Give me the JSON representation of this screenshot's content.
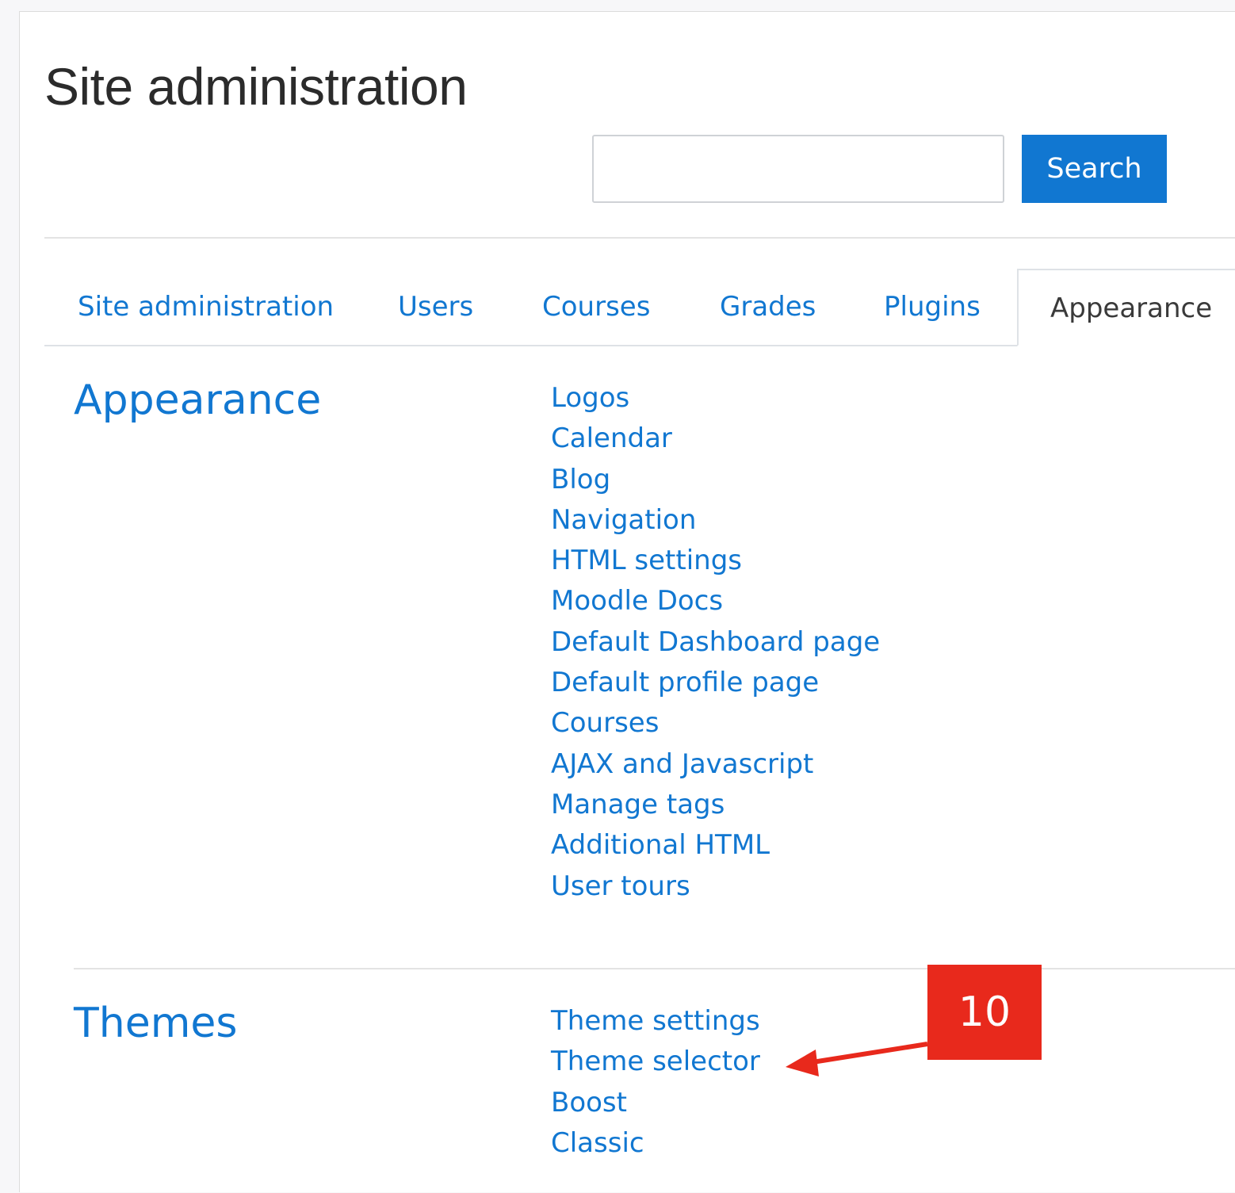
{
  "page_title": "Site administration",
  "search": {
    "value": "",
    "button_label": "Search"
  },
  "tabs": [
    {
      "label": "Site administration",
      "active": false
    },
    {
      "label": "Users",
      "active": false
    },
    {
      "label": "Courses",
      "active": false
    },
    {
      "label": "Grades",
      "active": false
    },
    {
      "label": "Plugins",
      "active": false
    },
    {
      "label": "Appearance",
      "active": true
    }
  ],
  "sections": [
    {
      "title": "Appearance",
      "links": [
        "Logos",
        "Calendar",
        "Blog",
        "Navigation",
        "HTML settings",
        "Moodle Docs",
        "Default Dashboard page",
        "Default profile page",
        "Courses",
        "AJAX and Javascript",
        "Manage tags",
        "Additional HTML",
        "User tours"
      ]
    },
    {
      "title": "Themes",
      "links": [
        "Theme settings",
        "Theme selector",
        "Boost",
        "Classic"
      ]
    }
  ],
  "callout": {
    "label": "10",
    "target": "Theme selector",
    "color": "#e8291c"
  },
  "colors": {
    "link": "#1177d1",
    "primary_button": "#1177d1",
    "callout": "#e8291c"
  }
}
